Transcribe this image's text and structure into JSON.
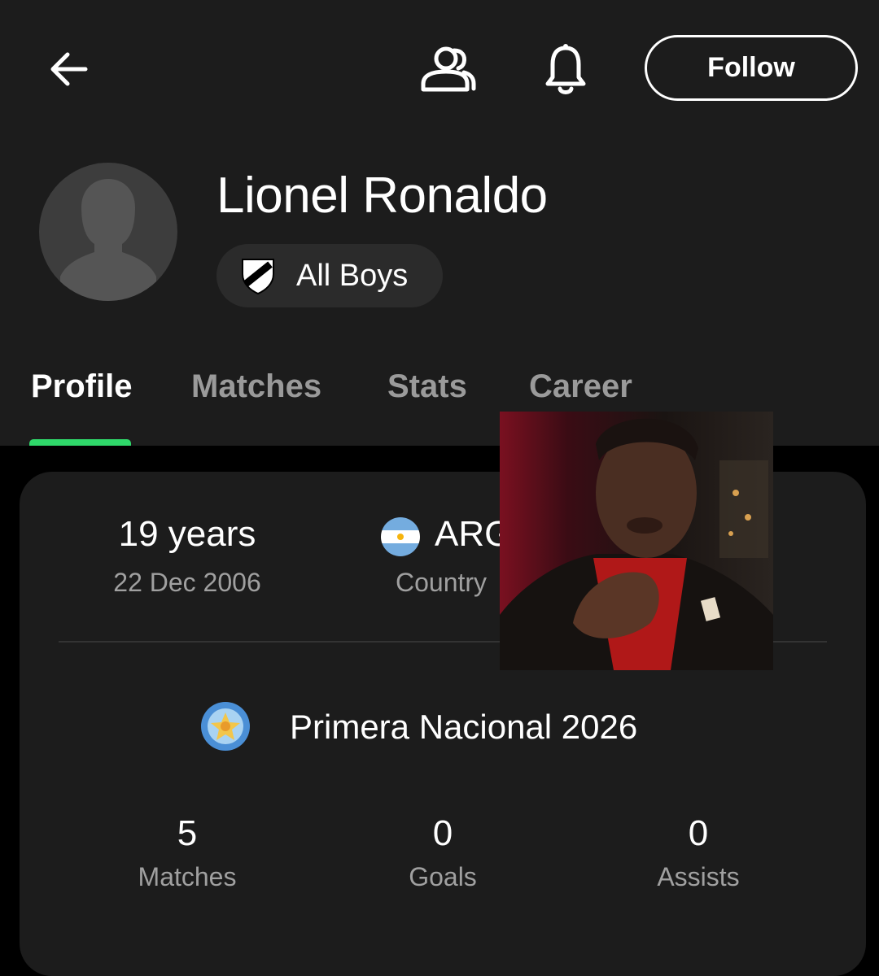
{
  "header": {
    "back_icon": "arrow-left-icon",
    "people_icon": "people-icon",
    "bell_icon": "bell-icon",
    "follow_label": "Follow"
  },
  "player": {
    "name": "Lionel Ronaldo",
    "avatar_icon": "person-silhouette-icon",
    "team": {
      "name": "All Boys",
      "crest_icon": "club-crest-icon"
    }
  },
  "tabs": [
    {
      "label": "Profile",
      "active": true
    },
    {
      "label": "Matches",
      "active": false
    },
    {
      "label": "Stats",
      "active": false
    },
    {
      "label": "Career",
      "active": false
    }
  ],
  "info": {
    "age_value": "19 years",
    "birth_date": "22 Dec 2006",
    "country_code": "ARG",
    "country_label": "Country",
    "flag_icon": "argentina-flag-icon"
  },
  "league": {
    "name": "Primera Nacional 2026",
    "logo_icon": "league-logo-icon"
  },
  "season_stats": [
    {
      "value": "5",
      "label": "Matches"
    },
    {
      "value": "0",
      "label": "Goals"
    },
    {
      "value": "0",
      "label": "Assists"
    }
  ],
  "colors": {
    "background": "#000000",
    "surface": "#1c1c1c",
    "chip": "#2b2b2b",
    "accent": "#2fd86a",
    "muted_text": "#9a9a9a"
  }
}
